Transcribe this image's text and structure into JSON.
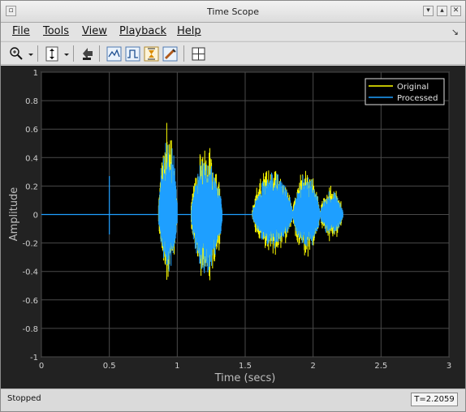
{
  "window": {
    "title": "Time Scope"
  },
  "menu": {
    "items": [
      "File",
      "Tools",
      "View",
      "Playback",
      "Help"
    ]
  },
  "toolbar": {
    "icons": [
      "zoom-icon",
      "dropdown-arrow-icon",
      "scale-axes-icon",
      "dropdown-arrow-icon",
      "step-forward-icon",
      "trigger-icon",
      "measurement-icon",
      "cursor-measurement-icon",
      "peak-finder-icon",
      "layout-icon"
    ]
  },
  "chart_data": {
    "type": "line",
    "xlabel": "Time (secs)",
    "ylabel": "Amplitude",
    "xlim": [
      0,
      3
    ],
    "ylim": [
      -1,
      1
    ],
    "xticks": [
      "0",
      "0.5",
      "1",
      "1.5",
      "2",
      "2.5",
      "3"
    ],
    "yticks": [
      "1",
      "0.8",
      "0.6",
      "0.4",
      "0.2",
      "0",
      "-0.2",
      "-0.4",
      "-0.6",
      "-0.8",
      "-1"
    ],
    "grid": true,
    "legend_position": "top-right",
    "series": [
      {
        "name": "Original",
        "color": "#ffff00"
      },
      {
        "name": "Processed",
        "color": "#1e9fff"
      }
    ],
    "bursts": [
      {
        "t0": 0.86,
        "t1": 1.0,
        "peak": 0.68,
        "trough": -0.5,
        "processed_peak": 0.6
      },
      {
        "t0": 1.1,
        "t1": 1.33,
        "peak": 0.52,
        "trough": -0.54,
        "processed_peak": 0.45
      },
      {
        "t0": 1.55,
        "t1": 1.85,
        "peak": 0.37,
        "trough": -0.3,
        "processed_peak": 0.32
      },
      {
        "t0": 1.85,
        "t1": 2.05,
        "peak": 0.34,
        "trough": -0.32,
        "processed_peak": 0.3
      },
      {
        "t0": 2.05,
        "t1": 2.22,
        "peak": 0.22,
        "trough": -0.2,
        "processed_peak": 0.18
      }
    ],
    "spikes": [
      {
        "t": 0.5,
        "value": 0.27,
        "trough": -0.14
      }
    ],
    "end_time": 2.22
  },
  "status": {
    "text": "Stopped",
    "time": "T=2.2059"
  },
  "colors": {
    "plot_bg": "#000000",
    "frame_bg": "#222222",
    "grid": "#4a4a4a",
    "axis_text": "#cfcfcf"
  }
}
